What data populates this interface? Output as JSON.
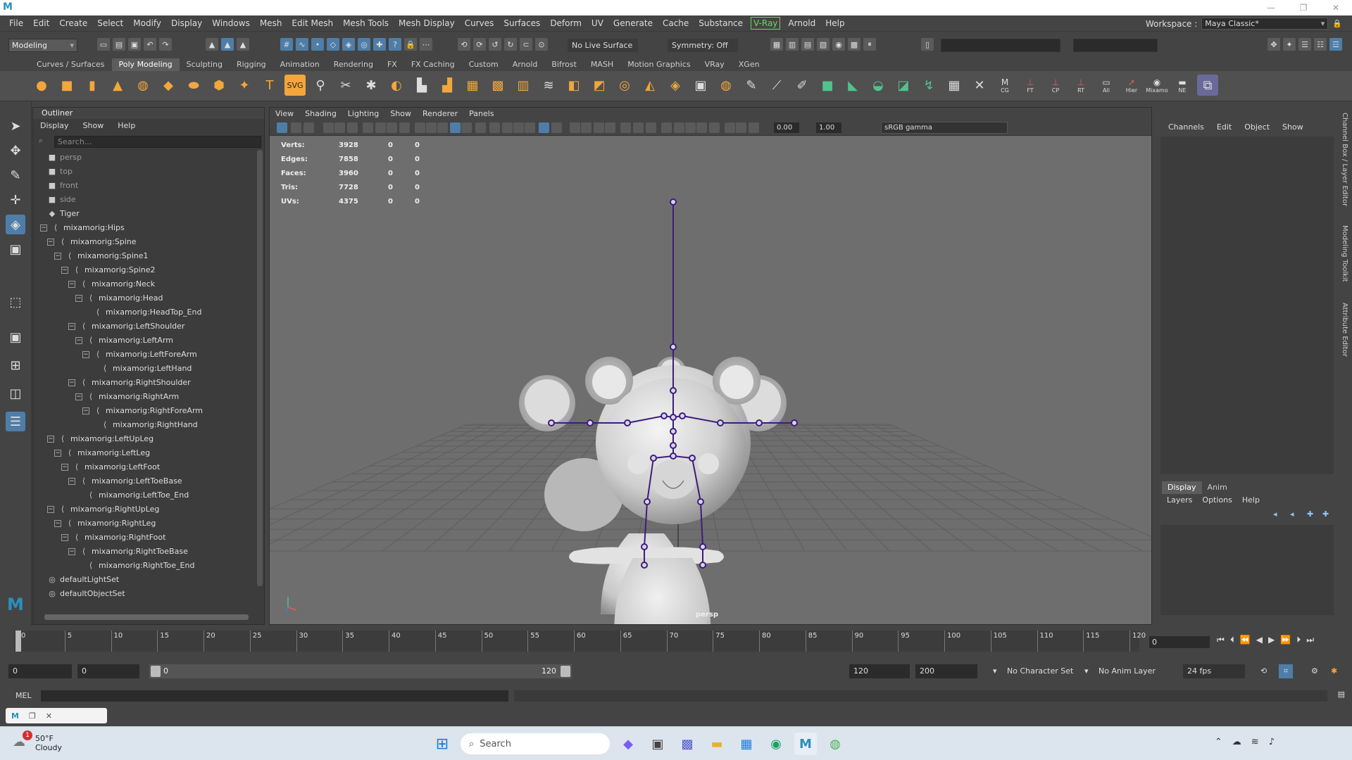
{
  "app": {
    "logo": "M"
  },
  "window_controls": [
    "—",
    "❐",
    "✕"
  ],
  "menu": [
    "File",
    "Edit",
    "Create",
    "Select",
    "Modify",
    "Display",
    "Windows",
    "Mesh",
    "Edit Mesh",
    "Mesh Tools",
    "Mesh Display",
    "Curves",
    "Surfaces",
    "Deform",
    "UV",
    "Generate",
    "Cache",
    "Substance",
    "V-Ray",
    "Arnold",
    "Help"
  ],
  "workspace": {
    "label": "Workspace :",
    "value": "Maya Classic*"
  },
  "status": {
    "menuset": "Modeling",
    "live_surface": "No Live Surface",
    "symmetry": "Symmetry: Off"
  },
  "shelf_tabs": [
    "Curves / Surfaces",
    "Poly Modeling",
    "Sculpting",
    "Rigging",
    "Animation",
    "Rendering",
    "FX",
    "FX Caching",
    "Custom",
    "Arnold",
    "Bifrost",
    "MASH",
    "Motion Graphics",
    "VRay",
    "XGen"
  ],
  "shelf_active": "Poly Modeling",
  "shelf_labels": [
    "CG",
    "FT",
    "CP",
    "RT",
    "All",
    "Hier",
    "Mixamo",
    "NE"
  ],
  "outliner": {
    "title": "Outliner",
    "menu": [
      "Display",
      "Show",
      "Help"
    ],
    "search_placeholder": "Search...",
    "items": [
      {
        "label": "persp",
        "depth": 0,
        "icon": "camera-icon",
        "dim": true,
        "exp": ""
      },
      {
        "label": "top",
        "depth": 0,
        "icon": "camera-icon",
        "dim": true,
        "exp": ""
      },
      {
        "label": "front",
        "depth": 0,
        "icon": "camera-icon",
        "dim": true,
        "exp": ""
      },
      {
        "label": "side",
        "depth": 0,
        "icon": "camera-icon",
        "dim": true,
        "exp": ""
      },
      {
        "label": "Tiger",
        "depth": 0,
        "icon": "mesh-icon",
        "dim": false,
        "exp": ""
      },
      {
        "label": "mixamorig:Hips",
        "depth": 0,
        "icon": "joint-icon",
        "dim": false,
        "exp": "-"
      },
      {
        "label": "mixamorig:Spine",
        "depth": 1,
        "icon": "joint-icon",
        "dim": false,
        "exp": "-"
      },
      {
        "label": "mixamorig:Spine1",
        "depth": 2,
        "icon": "joint-icon",
        "dim": false,
        "exp": "-"
      },
      {
        "label": "mixamorig:Spine2",
        "depth": 3,
        "icon": "joint-icon",
        "dim": false,
        "exp": "-"
      },
      {
        "label": "mixamorig:Neck",
        "depth": 4,
        "icon": "joint-icon",
        "dim": false,
        "exp": "-"
      },
      {
        "label": "mixamorig:Head",
        "depth": 5,
        "icon": "joint-icon",
        "dim": false,
        "exp": "-"
      },
      {
        "label": "mixamorig:HeadTop_End",
        "depth": 6,
        "icon": "joint-icon",
        "dim": false,
        "exp": ""
      },
      {
        "label": "mixamorig:LeftShoulder",
        "depth": 4,
        "icon": "joint-icon",
        "dim": false,
        "exp": "-"
      },
      {
        "label": "mixamorig:LeftArm",
        "depth": 5,
        "icon": "joint-icon",
        "dim": false,
        "exp": "-"
      },
      {
        "label": "mixamorig:LeftForeArm",
        "depth": 6,
        "icon": "joint-icon",
        "dim": false,
        "exp": "-"
      },
      {
        "label": "mixamorig:LeftHand",
        "depth": 7,
        "icon": "joint-icon",
        "dim": false,
        "exp": ""
      },
      {
        "label": "mixamorig:RightShoulder",
        "depth": 4,
        "icon": "joint-icon",
        "dim": false,
        "exp": "-"
      },
      {
        "label": "mixamorig:RightArm",
        "depth": 5,
        "icon": "joint-icon",
        "dim": false,
        "exp": "-"
      },
      {
        "label": "mixamorig:RightForeArm",
        "depth": 6,
        "icon": "joint-icon",
        "dim": false,
        "exp": "-"
      },
      {
        "label": "mixamorig:RightHand",
        "depth": 7,
        "icon": "joint-icon",
        "dim": false,
        "exp": ""
      },
      {
        "label": "mixamorig:LeftUpLeg",
        "depth": 1,
        "icon": "joint-icon",
        "dim": false,
        "exp": "-"
      },
      {
        "label": "mixamorig:LeftLeg",
        "depth": 2,
        "icon": "joint-icon",
        "dim": false,
        "exp": "-"
      },
      {
        "label": "mixamorig:LeftFoot",
        "depth": 3,
        "icon": "joint-icon",
        "dim": false,
        "exp": "-"
      },
      {
        "label": "mixamorig:LeftToeBase",
        "depth": 4,
        "icon": "joint-icon",
        "dim": false,
        "exp": "-"
      },
      {
        "label": "mixamorig:LeftToe_End",
        "depth": 5,
        "icon": "joint-icon",
        "dim": false,
        "exp": ""
      },
      {
        "label": "mixamorig:RightUpLeg",
        "depth": 1,
        "icon": "joint-icon",
        "dim": false,
        "exp": "-"
      },
      {
        "label": "mixamorig:RightLeg",
        "depth": 2,
        "icon": "joint-icon",
        "dim": false,
        "exp": "-"
      },
      {
        "label": "mixamorig:RightFoot",
        "depth": 3,
        "icon": "joint-icon",
        "dim": false,
        "exp": "-"
      },
      {
        "label": "mixamorig:RightToeBase",
        "depth": 4,
        "icon": "joint-icon",
        "dim": false,
        "exp": "-"
      },
      {
        "label": "mixamorig:RightToe_End",
        "depth": 5,
        "icon": "joint-icon",
        "dim": false,
        "exp": ""
      },
      {
        "label": "defaultLightSet",
        "depth": 0,
        "icon": "set-icon",
        "dim": false,
        "exp": ""
      },
      {
        "label": "defaultObjectSet",
        "depth": 0,
        "icon": "set-icon",
        "dim": false,
        "exp": ""
      }
    ]
  },
  "viewport": {
    "menu": [
      "View",
      "Shading",
      "Lighting",
      "Show",
      "Renderer",
      "Panels"
    ],
    "exposure": "0.00",
    "gamma_value": "1.00",
    "colorspace": "sRGB gamma",
    "camera": "persp",
    "stats": [
      {
        "label": "Verts:",
        "v1": "3928",
        "v2": "0",
        "v3": "0"
      },
      {
        "label": "Edges:",
        "v1": "7858",
        "v2": "0",
        "v3": "0"
      },
      {
        "label": "Faces:",
        "v1": "3960",
        "v2": "0",
        "v3": "0"
      },
      {
        "label": "Tris:",
        "v1": "7728",
        "v2": "0",
        "v3": "0"
      },
      {
        "label": "UVs:",
        "v1": "4375",
        "v2": "0",
        "v3": "0"
      }
    ]
  },
  "channelbox": {
    "menu": [
      "Channels",
      "Edit",
      "Object",
      "Show"
    ]
  },
  "layereditor": {
    "tabs": [
      "Display",
      "Anim"
    ],
    "menu": [
      "Layers",
      "Options",
      "Help"
    ]
  },
  "side_tabs": [
    "Channel Box / Layer Editor",
    "Modeling Toolkit",
    "Attribute Editor"
  ],
  "timeline": {
    "ticks": [
      0,
      5,
      10,
      15,
      20,
      25,
      30,
      35,
      40,
      45,
      50,
      55,
      60,
      65,
      70,
      75,
      80,
      85,
      90,
      95,
      100,
      105,
      110,
      115,
      120
    ],
    "current": "0"
  },
  "range": {
    "start_field": "0",
    "start2_field": "0",
    "slider_start": "0",
    "slider_end": "120",
    "end_field": "120",
    "end2_field": "200",
    "character_set": "No Character Set",
    "anim_layer": "No Anim Layer",
    "fps": "24 fps"
  },
  "cmd": {
    "label": "MEL"
  },
  "taskbar": {
    "weather_temp": "50°F",
    "weather_desc": "Cloudy",
    "weather_badge": "1",
    "search_placeholder": "Search"
  },
  "colors": {
    "accent": "#4e7ea8",
    "vray": "#6fd36f",
    "joint": "#3c1d7a"
  }
}
